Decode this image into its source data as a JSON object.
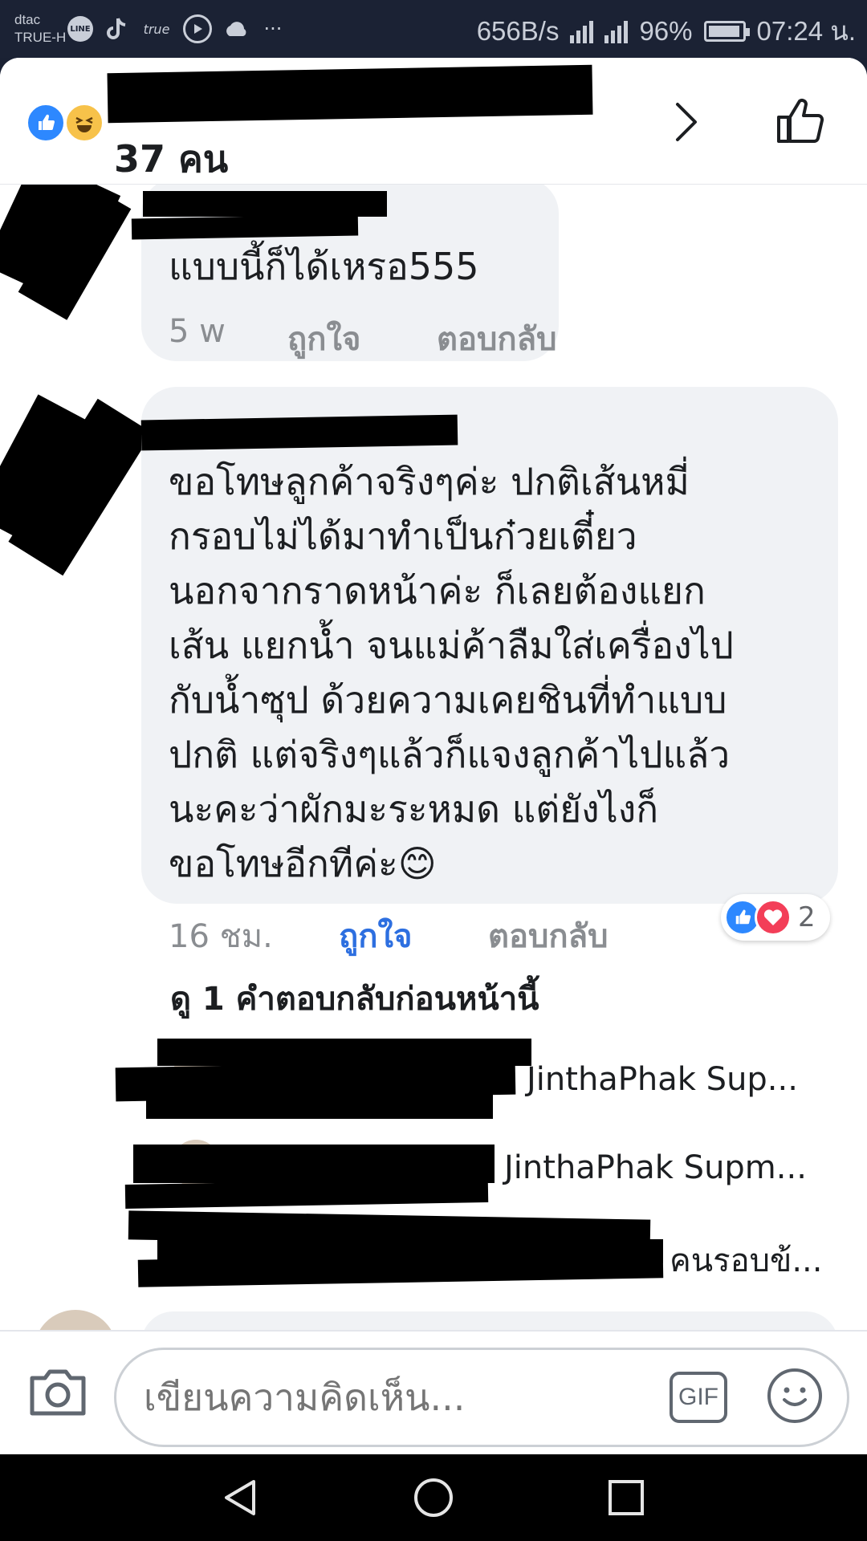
{
  "status_bar": {
    "carrier_1": "dtac",
    "carrier_2": "TRUE-H",
    "line_icon_text": "LINE",
    "true_icon_text": "true",
    "more": "···",
    "net_speed": "656B/s",
    "battery": "96%",
    "time": "07:24 น."
  },
  "header": {
    "count": "37 คน"
  },
  "comments": [
    {
      "text": "แบบนี้ก็ได้เหรอ555",
      "time": "5 w",
      "like": "ถูกใจ",
      "reply": "ตอบกลับ"
    },
    {
      "text": "ขอโทษลูกค้าจริงๆค่ะ ปกติเส้นหมี่\nกรอบไม่ได้มาทำเป็นก๋วยเตี๋ยว\nนอกจากราดหน้าค่ะ ก็เลยต้องแยก\nเส้น แยกน้ำ จนแม่ค้าลืมใส่เครื่องไป\nกับน้ำซุป ด้วยความเคยชินที่ทำแบบ\nปกติ แต่จริงๆแล้วก็แจงลูกค้าไปแล้ว\nนะคะว่าผักมะระหมด แต่ยังไงก็\nขอโทษอีกทีค่ะ😊",
      "time": "16 ชม.",
      "like": "ถูกใจ",
      "reply": "ตอบกลับ",
      "reaction_count": "2"
    }
  ],
  "view_previous": "ดู 1 คำตอบกลับก่อนหน้านี้",
  "replies": [
    "JinthaPhak Sup...",
    "JinthaPhak Supm...",
    "คนรอบข้..."
  ],
  "composer": {
    "placeholder": "เขียนความคิดเห็น...",
    "gif_label": "GIF"
  },
  "colors": {
    "accent": "#2d6fe0",
    "bubble": "#f0f2f5",
    "like_blue": "#2d88ff",
    "love_red": "#f33e58"
  }
}
